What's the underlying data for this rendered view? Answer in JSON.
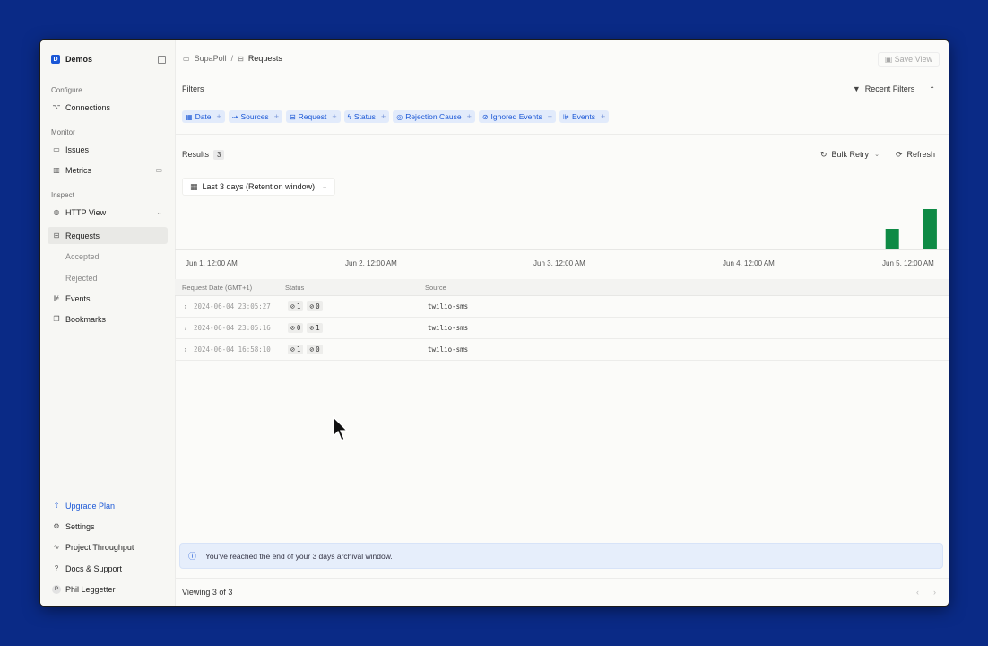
{
  "sidebar": {
    "workspace": {
      "badge": "D",
      "name": "Demos"
    },
    "sections": {
      "configure": "Configure",
      "monitor": "Monitor",
      "inspect": "Inspect"
    },
    "items": {
      "connections": "Connections",
      "issues": "Issues",
      "metrics": "Metrics",
      "http_view": "HTTP View",
      "requests": "Requests",
      "accepted": "Accepted",
      "rejected": "Rejected",
      "events": "Events",
      "bookmarks": "Bookmarks"
    },
    "bottom": {
      "upgrade": "Upgrade Plan",
      "settings": "Settings",
      "throughput": "Project Throughput",
      "docs": "Docs & Support",
      "user_initial": "P",
      "user": "Phil Leggetter"
    }
  },
  "topbar": {
    "crumb_project": "SupaPoll",
    "crumb_sep": "/",
    "crumb_current": "Requests",
    "save_view": "Save View"
  },
  "filters": {
    "title": "Filters",
    "recent": "Recent Filters",
    "chips": [
      {
        "label": "Date",
        "icon": "calendar-icon"
      },
      {
        "label": "Sources",
        "icon": "sources-icon"
      },
      {
        "label": "Request",
        "icon": "request-icon"
      },
      {
        "label": "Status",
        "icon": "bolt-icon"
      },
      {
        "label": "Rejection Cause",
        "icon": "alert-icon"
      },
      {
        "label": "Ignored Events",
        "icon": "ban-icon"
      },
      {
        "label": "Events",
        "icon": "events-icon"
      }
    ],
    "plus": "+"
  },
  "results": {
    "label": "Results",
    "count": "3",
    "bulk_retry": "Bulk Retry",
    "refresh": "Refresh",
    "range": "Last 3 days (Retention window)"
  },
  "chart_data": {
    "type": "bar",
    "x_tick_labels": [
      "Jun 1, 12:00 AM",
      "Jun 2, 12:00 AM",
      "Jun 3, 12:00 AM",
      "Jun 4, 12:00 AM",
      "Jun 5, 12:00 AM"
    ],
    "bins": 40,
    "values": [
      0,
      0,
      0,
      0,
      0,
      0,
      0,
      0,
      0,
      0,
      0,
      0,
      0,
      0,
      0,
      0,
      0,
      0,
      0,
      0,
      0,
      0,
      0,
      0,
      0,
      0,
      0,
      0,
      0,
      0,
      0,
      0,
      0,
      0,
      0,
      0,
      0,
      1,
      0,
      2
    ],
    "bar_color": "#0e8a45",
    "empty_color": "#e2e2e0",
    "ylim": [
      0,
      2
    ]
  },
  "table": {
    "headers": {
      "date": "Request Date (GMT+1)",
      "status": "Status",
      "source": "Source"
    },
    "rows": [
      {
        "date": "2024-06-04 23:05:27",
        "accepted": "1",
        "ignored": "0",
        "source": "twilio-sms"
      },
      {
        "date": "2024-06-04 23:05:16",
        "accepted": "0",
        "ignored": "1",
        "source": "twilio-sms"
      },
      {
        "date": "2024-06-04 16:58:10",
        "accepted": "1",
        "ignored": "0",
        "source": "twilio-sms"
      }
    ]
  },
  "banner": "You've reached the end of your 3 days archival window.",
  "footer": {
    "viewing": "Viewing 3 of 3",
    "prev": "‹",
    "next": "›"
  }
}
